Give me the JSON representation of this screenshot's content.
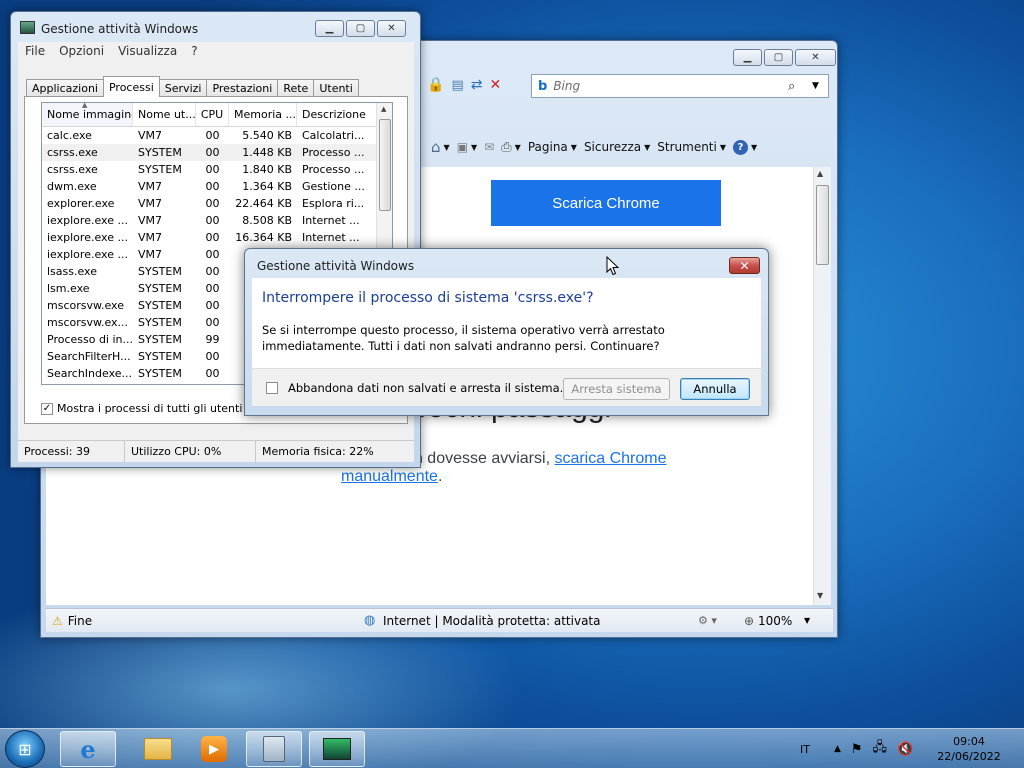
{
  "ie": {
    "search_placeholder": "Bing",
    "toolbar": {
      "page": "Pagina",
      "security": "Sicurezza",
      "tools": "Strumenti"
    },
    "content": {
      "download_button": "Scarica Chrome",
      "headline": "pochi passaggi",
      "paragraph_prefix": "nte. Se non dovesse avviarsi, ",
      "paragraph_link": "scarica Chrome manualmente",
      "paragraph_suffix": "."
    },
    "status": {
      "left": "Fine",
      "zone": "Internet | Modalità protetta: attivata",
      "zoom": "100%"
    }
  },
  "taskmgr": {
    "title": "Gestione attività Windows",
    "menu": [
      "File",
      "Opzioni",
      "Visualizza",
      "?"
    ],
    "tabs": [
      "Applicazioni",
      "Processi",
      "Servizi",
      "Prestazioni",
      "Rete",
      "Utenti"
    ],
    "active_tab": 1,
    "columns": [
      "Nome immagine",
      "Nome ut...",
      "CPU",
      "Memoria ...",
      "Descrizione"
    ],
    "rows": [
      [
        "calc.exe",
        "VM7",
        "00",
        "5.540 KB",
        "Calcolatri..."
      ],
      [
        "csrss.exe",
        "SYSTEM",
        "00",
        "1.448 KB",
        "Processo ..."
      ],
      [
        "csrss.exe",
        "SYSTEM",
        "00",
        "1.840 KB",
        "Processo ..."
      ],
      [
        "dwm.exe",
        "VM7",
        "00",
        "1.364 KB",
        "Gestione ..."
      ],
      [
        "explorer.exe",
        "VM7",
        "00",
        "22.464 KB",
        "Esplora ri..."
      ],
      [
        "iexplore.exe ...",
        "VM7",
        "00",
        "8.508 KB",
        "Internet ..."
      ],
      [
        "iexplore.exe ...",
        "VM7",
        "00",
        "16.364 KB",
        "Internet ..."
      ],
      [
        "iexplore.exe ...",
        "VM7",
        "00",
        "",
        ""
      ],
      [
        "lsass.exe",
        "SYSTEM",
        "00",
        "",
        ""
      ],
      [
        "lsm.exe",
        "SYSTEM",
        "00",
        "",
        ""
      ],
      [
        "mscorsvw.exe",
        "SYSTEM",
        "00",
        "",
        ""
      ],
      [
        "mscorsvw.ex...",
        "SYSTEM",
        "00",
        "",
        ""
      ],
      [
        "Processo di in...",
        "SYSTEM",
        "99",
        "",
        ""
      ],
      [
        "SearchFilterH...",
        "SYSTEM",
        "00",
        "",
        ""
      ],
      [
        "SearchIndexe...",
        "SYSTEM",
        "00",
        "",
        ""
      ]
    ],
    "selected_row": 1,
    "show_all_label": "Mostra i processi di tutti gli utenti",
    "show_all_checked": true,
    "status": {
      "processes": "Processi: 39",
      "cpu": "Utilizzo CPU: 0%",
      "memory": "Memoria fisica: 22%"
    }
  },
  "dialog": {
    "title": "Gestione attività Windows",
    "heading": "Interrompere il processo di sistema 'csrss.exe'?",
    "body": "Se si interrompe questo processo, il sistema operativo verrà arrestato immediatamente. Tutti i dati non salvati andranno persi. Continuare?",
    "checkbox_label": "Abbandona dati non salvati e arresta il sistema.",
    "shutdown_button": "Arresta sistema",
    "cancel_button": "Annulla"
  },
  "taskbar": {
    "language": "IT",
    "time": "09:04",
    "date": "22/06/2022"
  }
}
